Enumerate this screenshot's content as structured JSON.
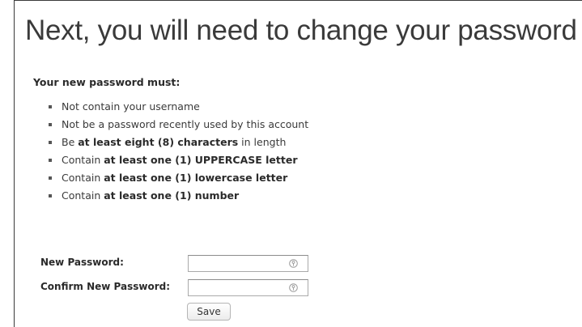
{
  "page": {
    "title": "Next, you will need to change your password",
    "subheading": "Your new password must:"
  },
  "rules": [
    {
      "parts": [
        {
          "text": "Not contain your username",
          "bold": false
        }
      ]
    },
    {
      "parts": [
        {
          "text": "Not be a password recently used by this account",
          "bold": false
        }
      ]
    },
    {
      "parts": [
        {
          "text": "Be ",
          "bold": false
        },
        {
          "text": "at least eight (8) characters",
          "bold": true
        },
        {
          "text": " in length",
          "bold": false
        }
      ]
    },
    {
      "parts": [
        {
          "text": "Contain ",
          "bold": false
        },
        {
          "text": "at least one (1) UPPERCASE letter",
          "bold": true
        }
      ]
    },
    {
      "parts": [
        {
          "text": "Contain ",
          "bold": false
        },
        {
          "text": "at least one (1) lowercase letter",
          "bold": true
        }
      ]
    },
    {
      "parts": [
        {
          "text": "Contain ",
          "bold": false
        },
        {
          "text": "at least one (1) number",
          "bold": true
        }
      ]
    }
  ],
  "form": {
    "new_password": {
      "label": "New Password:",
      "value": ""
    },
    "confirm_password": {
      "label": "Confirm New Password:",
      "value": ""
    },
    "save_label": "Save"
  },
  "icons": {
    "password_field_icon": "key-icon"
  }
}
